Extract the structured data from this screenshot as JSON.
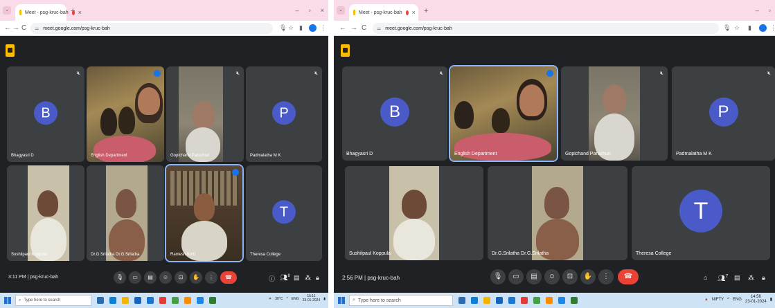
{
  "left": {
    "tab": {
      "title": "Meet - psg-kruc-bah"
    },
    "url": "meet.google.com/psg-kruc-bah",
    "profile_letter": "",
    "tiles": [
      {
        "name": "Bhagyasri D",
        "letter": "B"
      },
      {
        "name": "English Department"
      },
      {
        "name": "Gopichand Paruchuri"
      },
      {
        "name": "Padmalatha M K",
        "letter": "P"
      },
      {
        "name": "Sushilpaul Koppula"
      },
      {
        "name": "Dr.G.Srilatha Dr.G.Srilatha"
      },
      {
        "name": "Ramesh Kotti"
      },
      {
        "name": "Theresa College",
        "letter": "T"
      }
    ],
    "meeting_time": "3:11 PM",
    "meeting_code": "psg-kruc-bah",
    "participant_count": "8",
    "taskbar": {
      "search": "Type here to search",
      "weather": "30°C",
      "lang": "ENG",
      "time": "15:11",
      "date": "23-01-2024"
    }
  },
  "right": {
    "tab": {
      "title": "Meet - psg-kruc-bah"
    },
    "url": "meet.google.com/psg-kruc-bah",
    "tiles": [
      {
        "name": "Bhagyasri D",
        "letter": "B"
      },
      {
        "name": "English Department"
      },
      {
        "name": "Gopichand Paruchuri"
      },
      {
        "name": "Padmalatha M K",
        "letter": "P"
      },
      {
        "name": "Sushilpaul Koppula"
      },
      {
        "name": "Dr.G.Srilatha Dr.G.Srilatha"
      },
      {
        "name": "Theresa College",
        "letter": "T"
      }
    ],
    "meeting_time": "2:56 PM",
    "meeting_code": "psg-kruc-bah",
    "participant_count": "7",
    "taskbar": {
      "search": "Type here to search",
      "ticker": "NIFTY",
      "lang": "ENG",
      "time": "14:56",
      "date": "23-01-2024"
    }
  },
  "colors": {
    "avatar": "#4a5ac8",
    "end_call": "#ea4335",
    "accent": "#1a73e8"
  }
}
